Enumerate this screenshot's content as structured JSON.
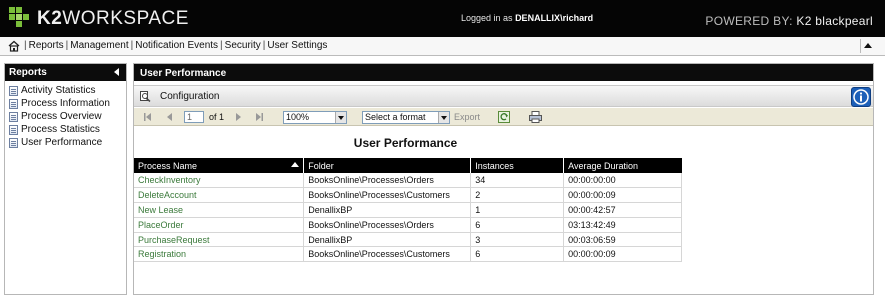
{
  "header": {
    "logo_k2": "K2",
    "logo_workspace": "WORKSPACE",
    "logged_in_prefix": "Logged in as",
    "logged_in_user": "DENALLIX\\richard",
    "powered_by": "POWERED BY:",
    "brand": "K2 blackpearl"
  },
  "menu": {
    "items": [
      {
        "label": "Reports"
      },
      {
        "label": "Management"
      },
      {
        "label": "Notification Events"
      },
      {
        "label": "Security"
      },
      {
        "label": "User Settings"
      }
    ]
  },
  "sidebar": {
    "title": "Reports",
    "items": [
      {
        "label": "Activity Statistics"
      },
      {
        "label": "Process Information"
      },
      {
        "label": "Process Overview"
      },
      {
        "label": "Process Statistics"
      },
      {
        "label": "User Performance"
      }
    ]
  },
  "main": {
    "title": "User Performance",
    "config_label": "Configuration",
    "toolbar": {
      "page_value": "1",
      "of_label": "of 1",
      "zoom_value": "100%",
      "format_value": "Select a format",
      "export_label": "Export"
    },
    "report_title": "User Performance",
    "table": {
      "headers": [
        "Process Name",
        "Folder",
        "Instances",
        "Average Duration"
      ],
      "rows": [
        {
          "process": "CheckInventory",
          "folder": "BooksOnline\\Processes\\Orders",
          "instances": "34",
          "duration": "00:00:00:00"
        },
        {
          "process": "DeleteAccount",
          "folder": "BooksOnline\\Processes\\Customers",
          "instances": "2",
          "duration": "00:00:00:09"
        },
        {
          "process": "New Lease",
          "folder": "DenallixBP",
          "instances": "1",
          "duration": "00:00:42:57"
        },
        {
          "process": "PlaceOrder",
          "folder": "BooksOnline\\Processes\\Orders",
          "instances": "6",
          "duration": "03:13:42:49"
        },
        {
          "process": "PurchaseRequest",
          "folder": "DenallixBP",
          "instances": "3",
          "duration": "00:03:06:59"
        },
        {
          "process": "Registration",
          "folder": "BooksOnline\\Processes\\Customers",
          "instances": "6",
          "duration": "00:00:00:09"
        }
      ]
    }
  },
  "colors": {
    "header_bg": "#050505",
    "logo_green": "#7bbf3a",
    "link_green": "#3b7a3b",
    "info_blue": "#1c5fb8",
    "toolbar_bg": "#ece9d8"
  },
  "icons": [
    "k2-logo-icon",
    "home-icon",
    "collapse-up-icon",
    "collapse-left-icon",
    "report-doc-icon",
    "configuration-icon",
    "info-icon",
    "first-page-icon",
    "previous-page-icon",
    "next-page-icon",
    "last-page-icon",
    "refresh-icon",
    "print-icon",
    "sort-ascending-icon"
  ]
}
